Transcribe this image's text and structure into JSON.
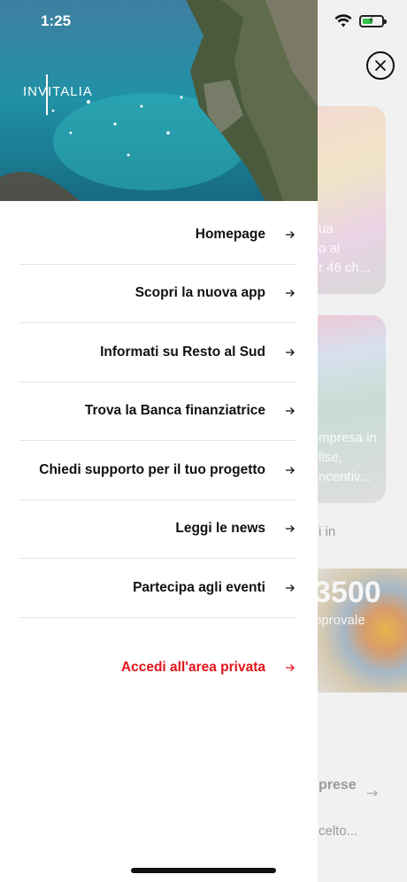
{
  "status": {
    "time": "1:25",
    "battery_level": 0.55
  },
  "hero": {
    "logo": "INVITALIA"
  },
  "menu": {
    "items": [
      {
        "label": "Homepage"
      },
      {
        "label": "Scopri la nuova app"
      },
      {
        "label": "Informati su Resto al Sud"
      },
      {
        "label": "Trova la Banca finanziatrice"
      },
      {
        "label": "Chiedi supporto per il tuo progetto"
      },
      {
        "label": "Leggi le news"
      },
      {
        "label": "Partecipa agli eventi"
      }
    ],
    "private_area": {
      "label": "Accedi all'area privata",
      "color": "#e1141a"
    }
  },
  "background": {
    "card1_text": [
      "ua",
      "o al",
      "r 46 ch..."
    ],
    "card2_text": [
      "mpresa in",
      "lise,",
      "ncentiv..."
    ],
    "section_text": "i in",
    "stat_value": "3500",
    "stat_label": "pprovale",
    "list_item_1": "prese",
    "list_item_2": "celto..."
  },
  "colors": {
    "accent": "#e1141a",
    "text": "#111111"
  }
}
